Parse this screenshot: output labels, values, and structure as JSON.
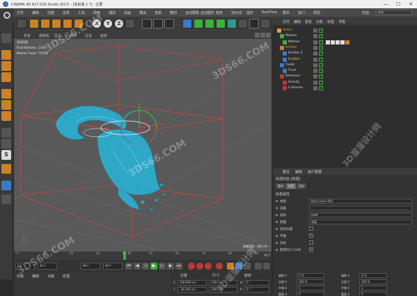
{
  "titlebar": {
    "title": "CINEMA 4D R17.016 Studio (R17) - [未标题 1 *] - 主要",
    "min": "—",
    "max": "☐",
    "close": "✕"
  },
  "menubar": {
    "items": [
      "文件",
      "编辑",
      "创建",
      "选择",
      "工具",
      "网格",
      "捕捉",
      "动画",
      "模拟",
      "渲染",
      "雕刻",
      "运动跟踪",
      "运动图形",
      "角色",
      "流水线",
      "插件",
      "RealFlow",
      "脚本",
      "窗口",
      "帮助"
    ],
    "interface_label": "界面",
    "interface_value": "启动"
  },
  "toolbar": {
    "xyz": [
      "X",
      "Y",
      "Z"
    ]
  },
  "viewport_menu": {
    "items": [
      "查看",
      "摄像机",
      "显示",
      "选项",
      "过滤",
      "面板"
    ]
  },
  "viewport": {
    "label": "透视视图",
    "stats": [
      {
        "label": "Fluid Particles",
        "value": "2144"
      },
      {
        "label": "Mesher: Faces",
        "value": "55784"
      }
    ],
    "grid_info": "网格间距 : 100 cm"
  },
  "timeline": {
    "ticks": [
      "0",
      "10",
      "20",
      "30",
      "40",
      "50",
      "60",
      "70",
      "80",
      "90"
    ],
    "current_frame": "45",
    "end_frame": "90 F"
  },
  "transport": {
    "start": "0 F",
    "current": "45 F",
    "end": "90 F",
    "end2": "90 F"
  },
  "materials": {
    "tabs": [
      "创建",
      "编辑",
      "功能",
      "纹理"
    ]
  },
  "coords": {
    "headers": [
      "位置",
      "尺寸",
      "旋转"
    ],
    "rows": [
      {
        "axis": "X",
        "pos": "106.956 cm",
        "size": "100 cm",
        "rot_label": "H",
        "rot": "0 °"
      },
      {
        "axis": "Y",
        "pos": "-30.343 cm",
        "size": "100 cm",
        "rot_label": "P",
        "rot": "0 °"
      }
    ]
  },
  "object_manager": {
    "tabs": [
      "文件",
      "编辑",
      "查看",
      "对象",
      "标签",
      "书签"
    ],
    "rows": [
      {
        "name": "Scene",
        "color": "orange",
        "indent": 0,
        "icon": "#e8a040"
      },
      {
        "name": "Mesher",
        "color": "white",
        "indent": 4,
        "icon": "#3fae3f"
      },
      {
        "name": "Mesher",
        "color": "white",
        "indent": 8,
        "icon": "#3fae3f",
        "tags": true
      },
      {
        "name": "Emitter",
        "color": "orange",
        "indent": 4,
        "icon": "#c9822a"
      },
      {
        "name": "Emitter 1",
        "color": "white",
        "indent": 8,
        "icon": "#3b7ac8"
      },
      {
        "name": "Emitter",
        "color": "yellow",
        "indent": 8,
        "icon": "#3b7ac8"
      },
      {
        "name": "Fluids",
        "color": "white",
        "indent": 4,
        "icon": "#3b7ac8"
      },
      {
        "name": "Fluid",
        "color": "white",
        "indent": 8,
        "icon": "#3b7ac8"
      },
      {
        "name": "Daemons",
        "color": "white",
        "indent": 4,
        "icon": "#b93a3a"
      },
      {
        "name": "Gravity",
        "color": "white",
        "indent": 8,
        "icon": "#b93a3a"
      },
      {
        "name": "k Volume",
        "color": "white",
        "indent": 8,
        "icon": "#b93a3a"
      }
    ]
  },
  "attribute_manager": {
    "tabs_head": [
      "模式",
      "编辑",
      "用户数据"
    ],
    "title": "纹理标签 [纹理]",
    "tabs": [
      "基本",
      "标签",
      "坐标"
    ],
    "section": "标签属性",
    "props": [
      {
        "label": "材质",
        "value": "Banji Glass 004",
        "type": "field"
      },
      {
        "label": "选集",
        "value": "",
        "type": "field"
      },
      {
        "label": "投射",
        "value": "UVW",
        "type": "field"
      },
      {
        "label": "侧面",
        "value": "双面",
        "type": "field"
      },
      {
        "label": "混合纹理",
        "value": "",
        "type": "check"
      },
      {
        "label": "平铺",
        "value": "✓",
        "type": "check"
      },
      {
        "label": "连续",
        "value": "",
        "type": "check"
      },
      {
        "label": "使用凹凸 UVW",
        "value": "✓",
        "type": "check"
      }
    ],
    "offset": {
      "labels": [
        "偏移 U",
        "长度 U",
        "平铺 U",
        "重复 U"
      ],
      "values": [
        "0 %",
        "100 %",
        "1",
        "0"
      ],
      "labels_v": [
        "偏移 V",
        "长度 V",
        "平铺 V",
        "重复 V"
      ],
      "values_v": [
        "0 %",
        "100 %",
        "1",
        "0"
      ]
    }
  },
  "watermarks": [
    "3DS66.COM",
    "3D溜溜设计网",
    "3DS66.COM"
  ]
}
